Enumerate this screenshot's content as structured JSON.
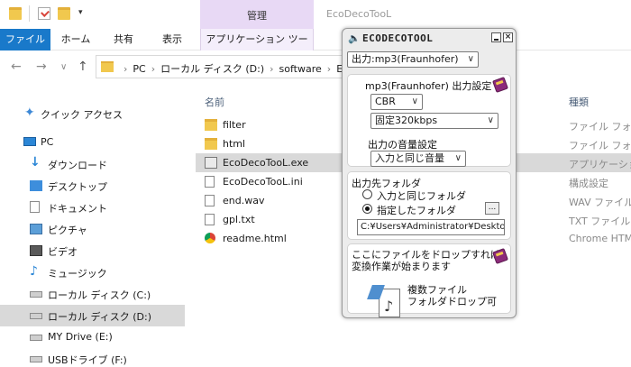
{
  "explorer": {
    "window_title": "EcoDecoTooL",
    "context_tab": "管理",
    "ribbon_tabs": [
      "ファイル",
      "ホーム",
      "共有",
      "表示",
      "アプリケーション ツール"
    ],
    "breadcrumb": [
      "PC",
      "ローカル ディスク (D:)",
      "software",
      "Eco"
    ],
    "sidebar": [
      {
        "label": "クイック アクセス",
        "icon": "star-icon"
      },
      {
        "label": "PC",
        "icon": "pc-icon"
      },
      {
        "label": "ダウンロード",
        "icon": "download-icon"
      },
      {
        "label": "デスクトップ",
        "icon": "desktop-icon"
      },
      {
        "label": "ドキュメント",
        "icon": "document-icon"
      },
      {
        "label": "ピクチャ",
        "icon": "picture-icon"
      },
      {
        "label": "ビデオ",
        "icon": "video-icon"
      },
      {
        "label": "ミュージック",
        "icon": "music-icon"
      },
      {
        "label": "ローカル ディスク (C:)",
        "icon": "drive-icon"
      },
      {
        "label": "ローカル ディスク (D:)",
        "icon": "drive-icon",
        "selected": true
      },
      {
        "label": "MY Drive (E:)",
        "icon": "drive-icon"
      },
      {
        "label": "USBドライブ (F:)",
        "icon": "drive-icon"
      }
    ],
    "columns": {
      "name": "名前",
      "type": "種類"
    },
    "files": [
      {
        "name": "filter",
        "type": "ファイル フォルダー",
        "icon": "folder-icon"
      },
      {
        "name": "html",
        "type": "ファイル フォルダー",
        "icon": "folder-icon"
      },
      {
        "name": "EcoDecoTooL.exe",
        "type": "アプリケーション",
        "icon": "exe-icon",
        "selected": true
      },
      {
        "name": "EcoDecoTooL.ini",
        "type": "構成設定",
        "icon": "ini-icon"
      },
      {
        "name": "end.wav",
        "type": "WAV ファイル",
        "icon": "wav-icon"
      },
      {
        "name": "gpl.txt",
        "type": "TXT ファイル",
        "icon": "txt-icon"
      },
      {
        "name": "readme.html",
        "type": "Chrome HTML",
        "icon": "chrome-icon"
      }
    ]
  },
  "eco": {
    "title": "ECODECOTOOL",
    "output_select": "出力:mp3(Fraunhofer)",
    "settings_heading": "mp3(Fraunhofer) 出力設定",
    "mode_select": "CBR",
    "bitrate_select": "固定320kbps",
    "volume_heading": "出力の音量設定",
    "volume_select": "入力と同じ音量",
    "folder_heading": "出力先フォルダ",
    "radio_same": "入力と同じフォルダ",
    "radio_specified": "指定したフォルダ",
    "browse_label": "...",
    "folder_path": "C:¥Users¥Administrator¥Desktop",
    "drop_line1": "ここにファイルをドロップすれば",
    "drop_line2": "変換作業が始まります",
    "multi_line1": "複数ファイル",
    "multi_line2": "フォルダドロップ可"
  }
}
